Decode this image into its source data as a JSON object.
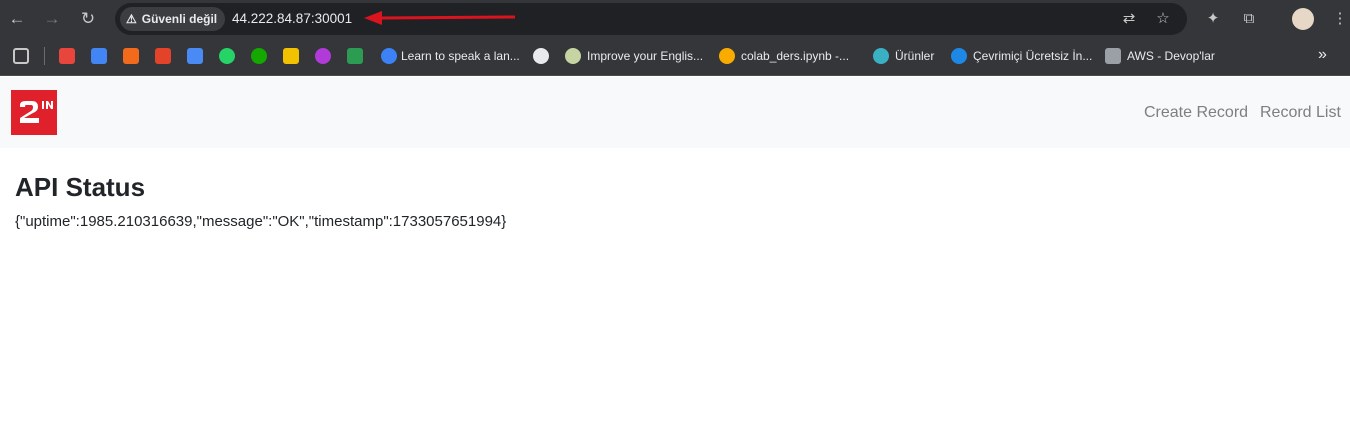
{
  "browser": {
    "security_label": "Güvenli değil",
    "url": "44.222.84.87:30001"
  },
  "bookmarks": [
    {
      "label": "Learn to speak a lan...",
      "icon": "duolingo-icon"
    },
    {
      "label": "Improve your Englis...",
      "icon": "people-icon"
    },
    {
      "label": "colab_ders.ipynb -...",
      "icon": "colab-icon"
    },
    {
      "label": "Ürünler",
      "icon": "leaf-icon"
    },
    {
      "label": "Çevrimiçi Ücretsiz İn...",
      "icon": "edge-icon"
    },
    {
      "label": "AWS - Devop'lar",
      "icon": "aws-icon"
    }
  ],
  "app": {
    "logo_text": "2ᴵᴺ",
    "nav": {
      "create_record": "Create Record",
      "record_list": "Record List"
    },
    "title": "API Status",
    "status_json": "{\"uptime\":1985.210316639,\"message\":\"OK\",\"timestamp\":1733057651994}"
  },
  "colors": {
    "brand": "#e0202a",
    "annotation_arrow": "#d9141f"
  }
}
